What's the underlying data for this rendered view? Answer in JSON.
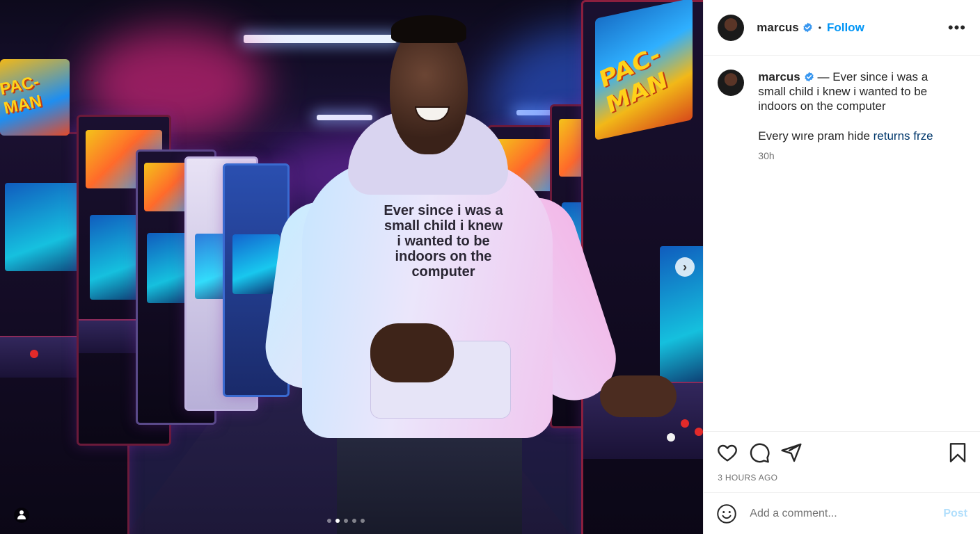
{
  "media": {
    "shirt_text": "Ever since i was a\nsmall child i knew\ni wanted to be\nindoors on the\ncomputer",
    "marquee_text": "PAC-MAN",
    "marquee_text_left": "PAC-MAN",
    "carousel": {
      "count": 5,
      "active_index": 1
    },
    "icons": {
      "next": "chevron-right-icon",
      "tag": "user-tag-icon"
    }
  },
  "header": {
    "username": "marcus",
    "verified": true,
    "separator": "•",
    "follow_label": "Follow",
    "more_label": "•••"
  },
  "caption": {
    "username": "marcus",
    "text": " — Ever since i was a small child i knew i wanted to be indoors on the computer",
    "extra_text": "Every wıre pram hide ",
    "extra_link": "returns frze",
    "time": "30h"
  },
  "actions": {
    "icons": [
      "heart-icon",
      "comment-icon",
      "share-icon",
      "bookmark-icon"
    ],
    "timestamp": "3 HOURS AGO"
  },
  "comment_box": {
    "placeholder": "Add a comment...",
    "post_label": "Post"
  },
  "colors": {
    "link_blue": "#0095f6",
    "post_disabled": "#b2dffc",
    "verified_blue": "#3897f0"
  }
}
